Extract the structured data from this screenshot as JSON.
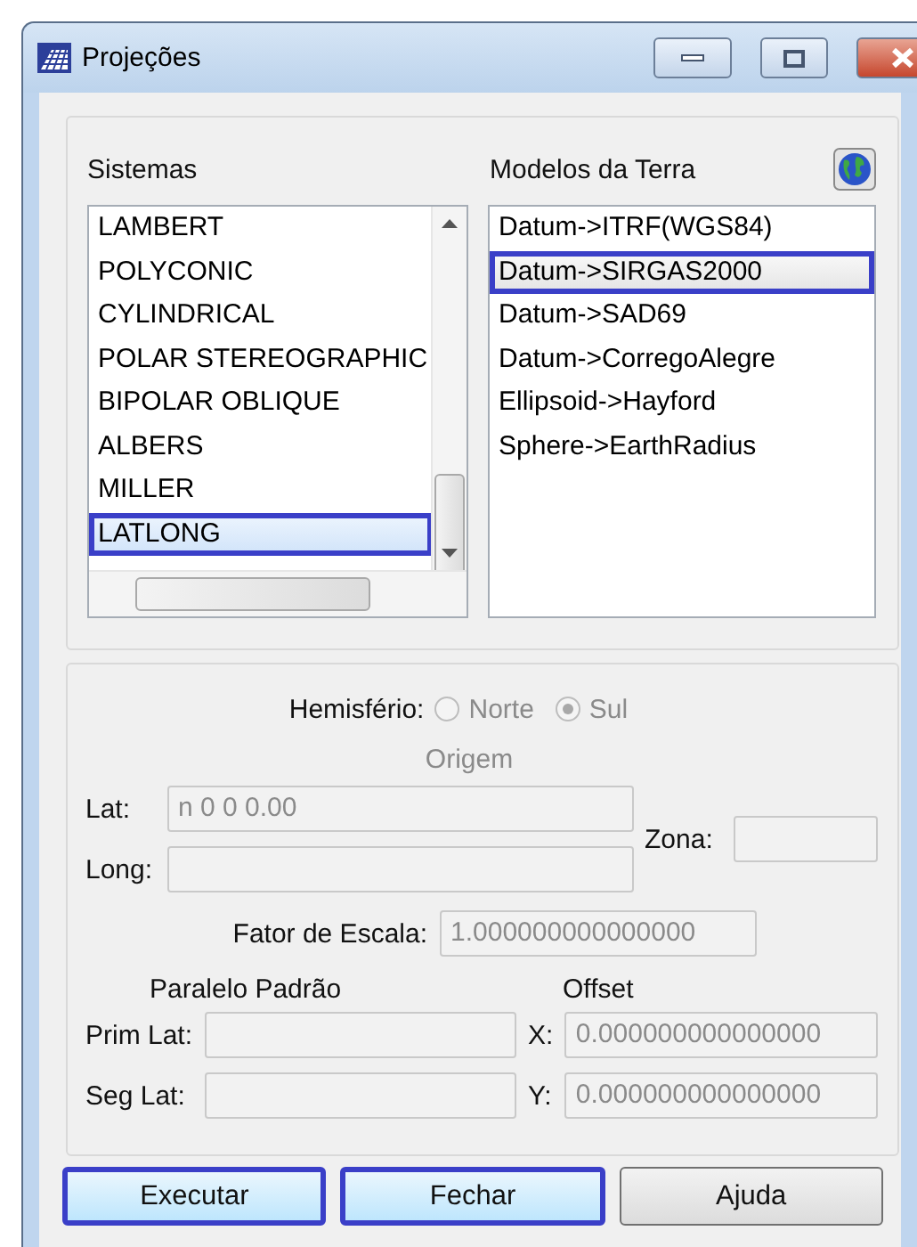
{
  "window": {
    "title": "Projeções"
  },
  "sistemas": {
    "label": "Sistemas",
    "items": [
      {
        "label": "LAMBERT",
        "selected": false,
        "highlighted": false
      },
      {
        "label": "POLYCONIC",
        "selected": false,
        "highlighted": false
      },
      {
        "label": "CYLINDRICAL",
        "selected": false,
        "highlighted": false
      },
      {
        "label": "POLAR STEREOGRAPHIC",
        "selected": false,
        "highlighted": false
      },
      {
        "label": "BIPOLAR OBLIQUE",
        "selected": false,
        "highlighted": false
      },
      {
        "label": "ALBERS",
        "selected": false,
        "highlighted": false
      },
      {
        "label": "MILLER",
        "selected": false,
        "highlighted": false
      },
      {
        "label": "LATLONG",
        "selected": true,
        "highlighted": true
      }
    ]
  },
  "modelos": {
    "label": "Modelos da Terra",
    "items": [
      {
        "label": "Datum->ITRF(WGS84)",
        "selected": false,
        "highlighted": false
      },
      {
        "label": "Datum->SIRGAS2000",
        "selected": true,
        "highlighted": true
      },
      {
        "label": "Datum->SAD69",
        "selected": false,
        "highlighted": false
      },
      {
        "label": "Datum->CorregoAlegre",
        "selected": false,
        "highlighted": false
      },
      {
        "label": "Ellipsoid->Hayford",
        "selected": false,
        "highlighted": false
      },
      {
        "label": "Sphere->EarthRadius",
        "selected": false,
        "highlighted": false
      }
    ]
  },
  "hemisferio": {
    "label": "Hemisfério:",
    "disabled": true,
    "options": [
      {
        "label": "Norte",
        "selected": false
      },
      {
        "label": "Sul",
        "selected": true
      }
    ]
  },
  "origem": {
    "title": "Origem",
    "lat": {
      "label": "Lat:",
      "value": "n 0 0 0.00"
    },
    "long": {
      "label": "Long:"
    },
    "zona": {
      "label": "Zona:"
    }
  },
  "fator_escala": {
    "label": "Fator de Escala:",
    "value": "1.000000000000000"
  },
  "paralelo_padrao": {
    "title": "Paralelo Padrão",
    "prim_lat": {
      "label": "Prim Lat:"
    },
    "seg_lat": {
      "label": "Seg Lat:"
    }
  },
  "offset": {
    "title": "Offset",
    "x": {
      "label": "X:",
      "value": "0.000000000000000"
    },
    "y": {
      "label": "Y:",
      "value": "0.000000000000000"
    }
  },
  "buttons": [
    {
      "label": "Executar",
      "highlighted": true
    },
    {
      "label": "Fechar",
      "highlighted": true
    },
    {
      "label": "Ajuda",
      "highlighted": false
    }
  ]
}
